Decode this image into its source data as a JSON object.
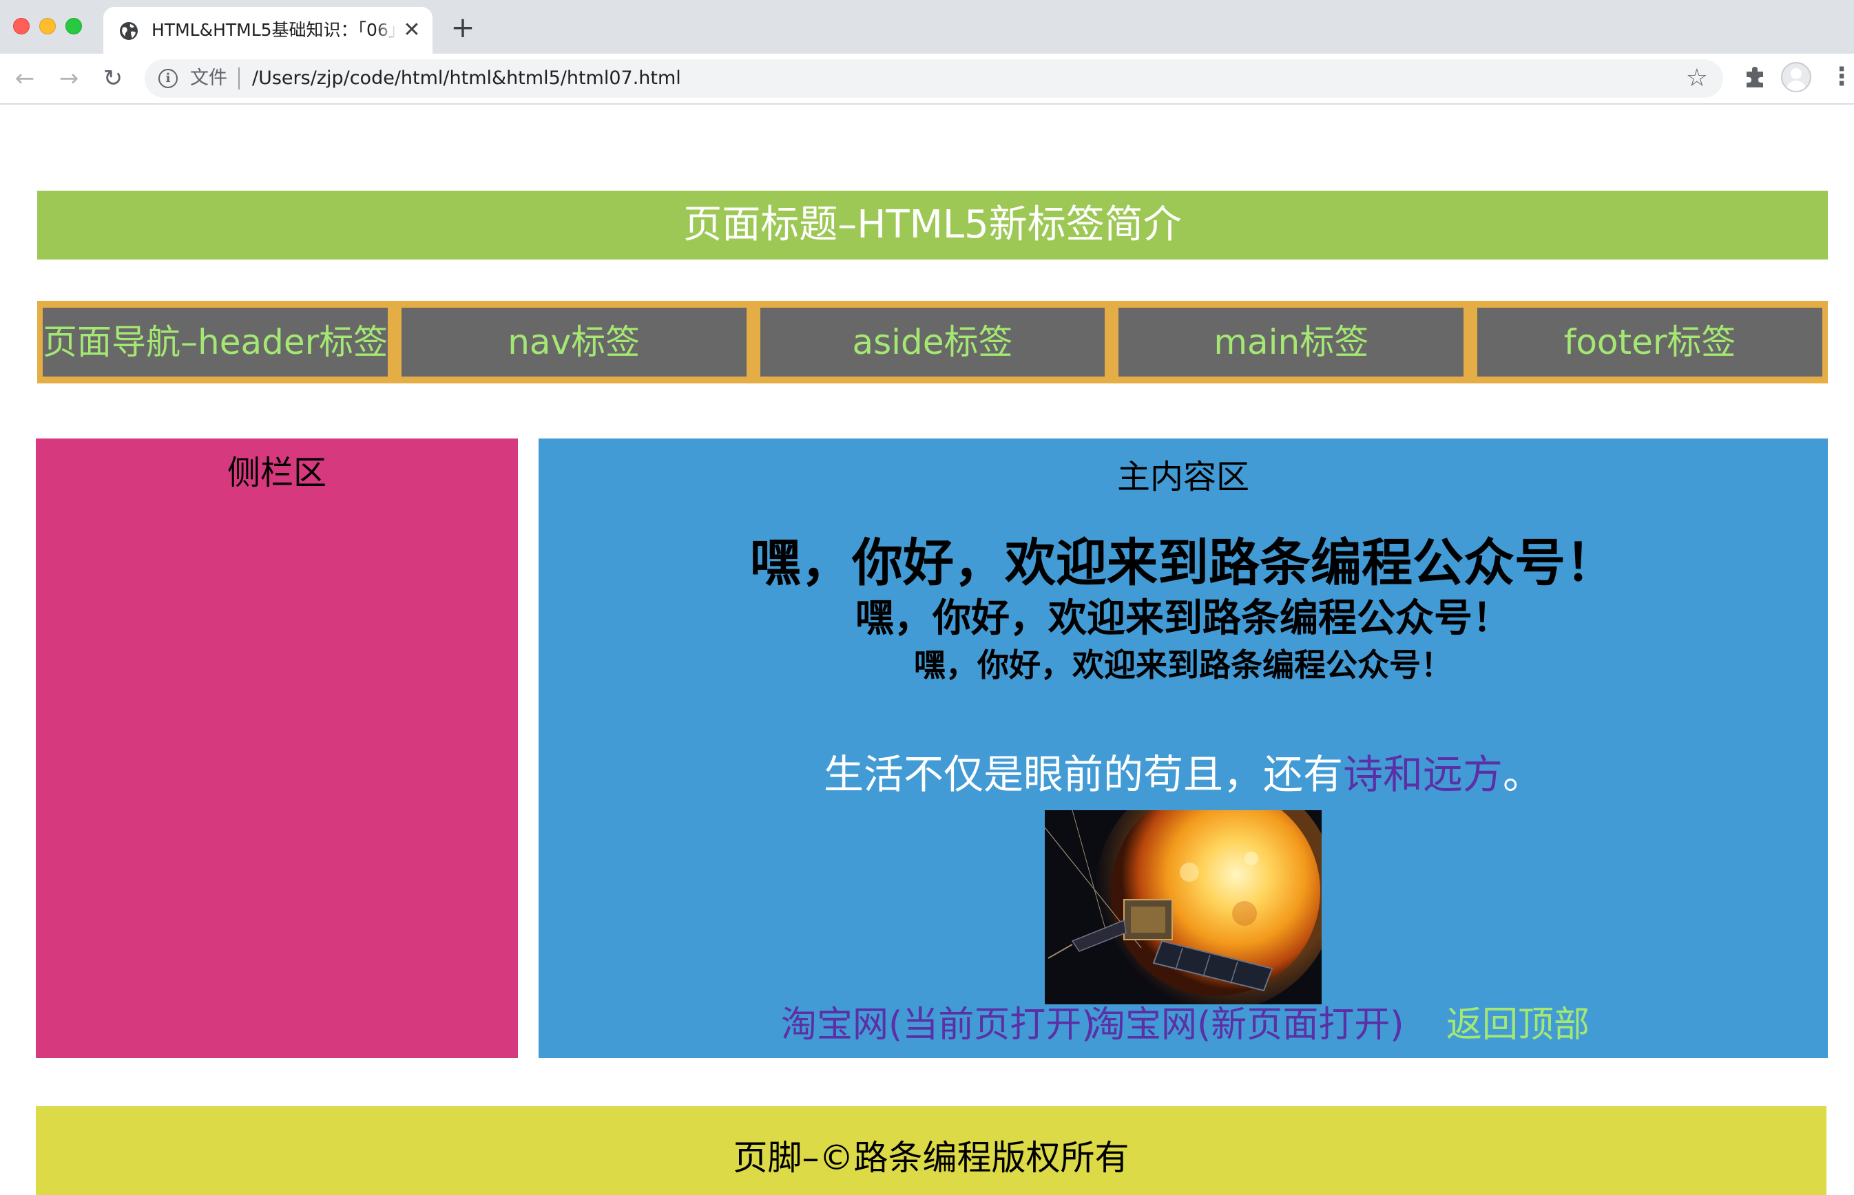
{
  "browser": {
    "tab_title": "HTML&HTML5基础知识：「06」",
    "tab_close": "✕",
    "new_tab": "+",
    "back": "←",
    "forward": "→",
    "reload": "↻",
    "info": "i",
    "url_scheme": "文件",
    "url": "/Users/zjp/code/html/html&html5/html07.html",
    "bookmark": "☆",
    "menu": "⋮"
  },
  "page": {
    "header_title": "页面标题–HTML5新标签简介",
    "nav_items": [
      {
        "label": "页面导航–header标签"
      },
      {
        "label": "nav标签"
      },
      {
        "label": "aside标签"
      },
      {
        "label": "main标签"
      },
      {
        "label": "footer标签"
      }
    ],
    "aside_title": "侧栏区",
    "main": {
      "title": "主内容区",
      "greeting_1": "嘿，你好，欢迎来到路条编程公众号！",
      "greeting_2": "嘿，你好，欢迎来到路条编程公众号！",
      "greeting_3": "嘿，你好，欢迎来到路条编程公众号！",
      "poem_prefix": "生活不仅是眼前的苟且，还有",
      "poem_emphasis": "诗和远方",
      "poem_suffix": "。",
      "link_same_page": "淘宝网(当前页打开)",
      "link_new_page": "淘宝网(新页面打开)",
      "link_back_top": "返回顶部"
    },
    "footer_text": "页脚–©路条编程版权所有"
  },
  "colors": {
    "header_bg": "#9dc855",
    "nav_border": "#e4ad45",
    "nav_item_bg": "#686868",
    "nav_text": "#a4e873",
    "aside_bg": "#d7397f",
    "main_bg": "#439bd5",
    "link_color": "#5b2fa6",
    "footer_bg": "#dcda46"
  }
}
